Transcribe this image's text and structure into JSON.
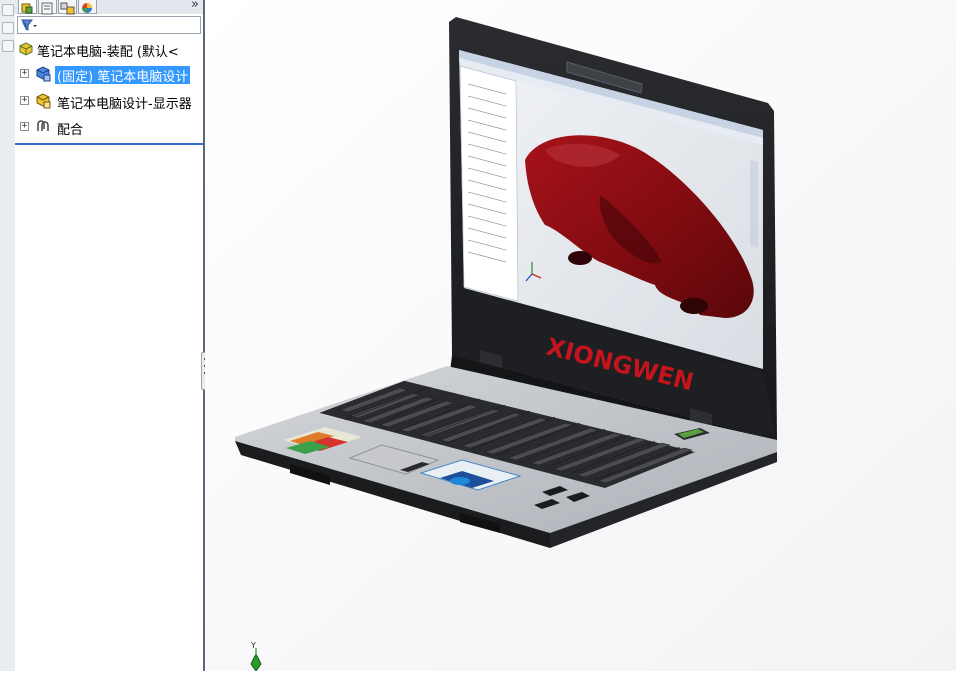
{
  "tree": {
    "root_label": "笔记本电脑-装配  (默认<",
    "items": [
      {
        "label": "(固定) 笔记本电脑设计",
        "selected": true
      },
      {
        "label": "笔记本电脑设计-显示器",
        "selected": false
      },
      {
        "label": "配合",
        "selected": false
      }
    ]
  },
  "panel": {
    "more_glyph": "»"
  },
  "laptop": {
    "lid_brand": "XIONGWEN"
  },
  "triad": {
    "axis_label": "Y"
  },
  "colors": {
    "selection": "#3399ff",
    "car_body": "#8b0a0a",
    "lid_brand": "#c4141c",
    "panel_accent": "#3a6fd0"
  }
}
